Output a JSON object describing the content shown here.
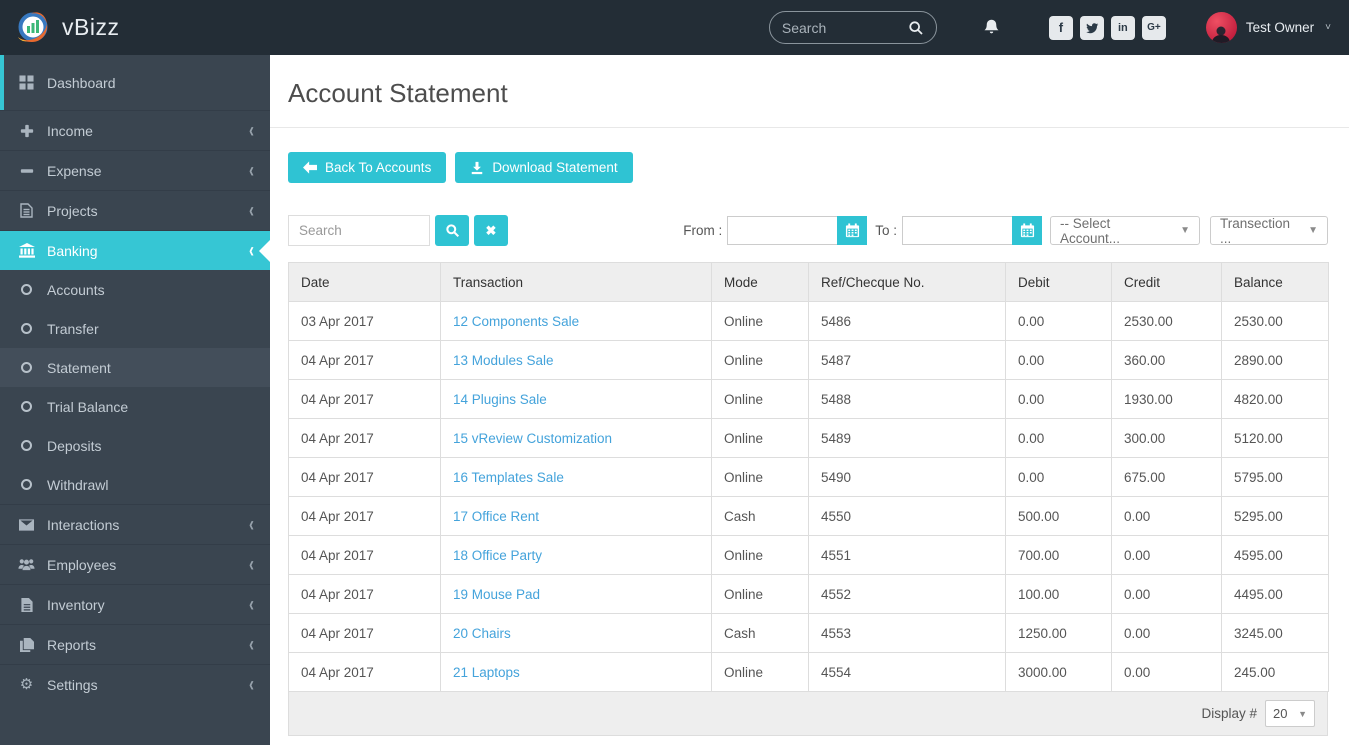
{
  "navbar": {
    "brand": "vBizz",
    "search_placeholder": "Search",
    "user_name": "Test Owner"
  },
  "sidebar": {
    "items": [
      {
        "label": "Dashboard"
      },
      {
        "label": "Income"
      },
      {
        "label": "Expense"
      },
      {
        "label": "Projects"
      },
      {
        "label": "Banking"
      },
      {
        "label": "Accounts"
      },
      {
        "label": "Transfer"
      },
      {
        "label": "Statement"
      },
      {
        "label": "Trial Balance"
      },
      {
        "label": "Deposits"
      },
      {
        "label": "Withdrawl"
      },
      {
        "label": "Interactions"
      },
      {
        "label": "Employees"
      },
      {
        "label": "Inventory"
      },
      {
        "label": "Reports"
      },
      {
        "label": "Settings"
      }
    ]
  },
  "page": {
    "title": "Account Statement",
    "back_button": "Back To Accounts",
    "download_button": "Download Statement"
  },
  "filters": {
    "search_placeholder": "Search",
    "from_label": "From :",
    "from_value": "",
    "to_label": "To :",
    "to_value": "",
    "account_select": "-- Select Account...",
    "transaction_select": "Transection ..."
  },
  "table": {
    "columns": [
      "Date",
      "Transaction",
      "Mode",
      "Ref/Checque No.",
      "Debit",
      "Credit",
      "Balance"
    ],
    "rows": [
      {
        "date": "03 Apr 2017",
        "transaction": "12 Components Sale",
        "mode": "Online",
        "ref": "5486",
        "debit": "0.00",
        "credit": "2530.00",
        "balance": "2530.00"
      },
      {
        "date": "04 Apr 2017",
        "transaction": "13 Modules Sale",
        "mode": "Online",
        "ref": "5487",
        "debit": "0.00",
        "credit": "360.00",
        "balance": "2890.00"
      },
      {
        "date": "04 Apr 2017",
        "transaction": "14 Plugins Sale",
        "mode": "Online",
        "ref": "5488",
        "debit": "0.00",
        "credit": "1930.00",
        "balance": "4820.00"
      },
      {
        "date": "04 Apr 2017",
        "transaction": "15 vReview Customization",
        "mode": "Online",
        "ref": "5489",
        "debit": "0.00",
        "credit": "300.00",
        "balance": "5120.00"
      },
      {
        "date": "04 Apr 2017",
        "transaction": "16 Templates Sale",
        "mode": "Online",
        "ref": "5490",
        "debit": "0.00",
        "credit": "675.00",
        "balance": "5795.00"
      },
      {
        "date": "04 Apr 2017",
        "transaction": "17 Office Rent",
        "mode": "Cash",
        "ref": "4550",
        "debit": "500.00",
        "credit": "0.00",
        "balance": "5295.00"
      },
      {
        "date": "04 Apr 2017",
        "transaction": "18 Office Party",
        "mode": "Online",
        "ref": "4551",
        "debit": "700.00",
        "credit": "0.00",
        "balance": "4595.00"
      },
      {
        "date": "04 Apr 2017",
        "transaction": "19 Mouse Pad",
        "mode": "Online",
        "ref": "4552",
        "debit": "100.00",
        "credit": "0.00",
        "balance": "4495.00"
      },
      {
        "date": "04 Apr 2017",
        "transaction": "20 Chairs",
        "mode": "Cash",
        "ref": "4553",
        "debit": "1250.00",
        "credit": "0.00",
        "balance": "3245.00"
      },
      {
        "date": "04 Apr 2017",
        "transaction": "21 Laptops",
        "mode": "Online",
        "ref": "4554",
        "debit": "3000.00",
        "credit": "0.00",
        "balance": "245.00"
      }
    ],
    "footer": {
      "display_label": "Display #",
      "display_value": "20"
    }
  },
  "colors": {
    "teal_accent": "#36c6d4",
    "teal_button": "#2fc3d3",
    "navbar_bg": "#232d36",
    "sidebar_bg": "#3a4550",
    "link": "#44a3db",
    "table_header_bg": "#eeeeee",
    "avatar_bg": "#c31f3e"
  }
}
